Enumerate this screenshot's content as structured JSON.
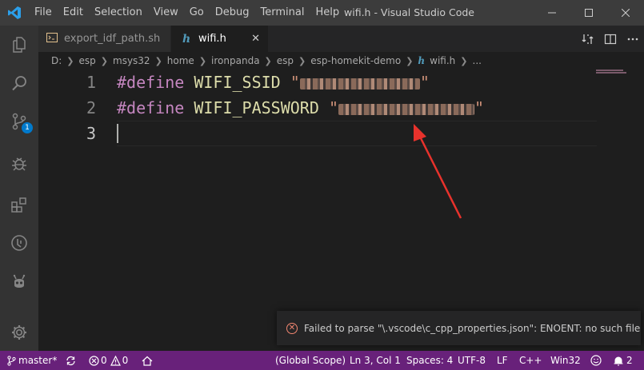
{
  "menu": [
    "File",
    "Edit",
    "Selection",
    "View",
    "Go",
    "Debug",
    "Terminal",
    "Help"
  ],
  "window_title": "wifi.h - Visual Studio Code",
  "activity": {
    "scm_badge": "1"
  },
  "tabs": [
    {
      "label": "export_idf_path.sh",
      "icon": "shell-file-icon"
    },
    {
      "label": "wifi.h",
      "icon": "h-file-icon",
      "close": "✕"
    }
  ],
  "breadcrumbs": [
    "D:",
    "esp",
    "msys32",
    "home",
    "ironpanda",
    "esp",
    "esp-homekit-demo",
    "wifi.h",
    "..."
  ],
  "editor": {
    "lines": [
      {
        "number": "1",
        "keyword": "#define",
        "macro": "WIFI_SSID",
        "string_open": "\"",
        "string_close": "\""
      },
      {
        "number": "2",
        "keyword": "#define",
        "macro": "WIFI_PASSWORD",
        "string_open": "\"",
        "string_close": "\""
      },
      {
        "number": "3"
      }
    ]
  },
  "notification": {
    "message": "Failed to parse \"\\.vscode\\c_cpp_properties.json\": ENOENT: no such file ..."
  },
  "statusbar": {
    "branch": "master*",
    "errors": "0",
    "warnings": "0",
    "scope": "(Global Scope)",
    "position": "Ln 3, Col 1",
    "spaces": "Spaces: 4",
    "encoding": "UTF-8",
    "eol": "LF",
    "language": "C++",
    "platform": "Win32",
    "notifications": "2"
  },
  "colors": {
    "statusbar": "#68217a",
    "annotation_arrow": "#e8322c"
  }
}
